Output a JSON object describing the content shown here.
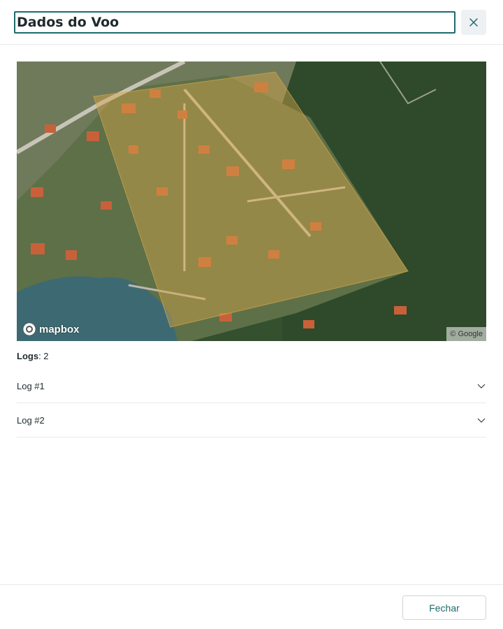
{
  "header": {
    "title_value": "Dados do Voo",
    "close_icon": "close-icon"
  },
  "map": {
    "provider_logo": "mapbox",
    "attribution": "© Google",
    "overlay_color": "#d8a64a"
  },
  "logs": {
    "count_label": "Logs",
    "count_value": "2",
    "items": [
      {
        "label": "Log #1",
        "icon": "chevron-down-icon"
      },
      {
        "label": "Log #2",
        "icon": "chevron-down-icon"
      }
    ]
  },
  "footer": {
    "close_label": "Fechar"
  },
  "colors": {
    "accent": "#1f6a6e",
    "border": "#e6e9ec"
  }
}
